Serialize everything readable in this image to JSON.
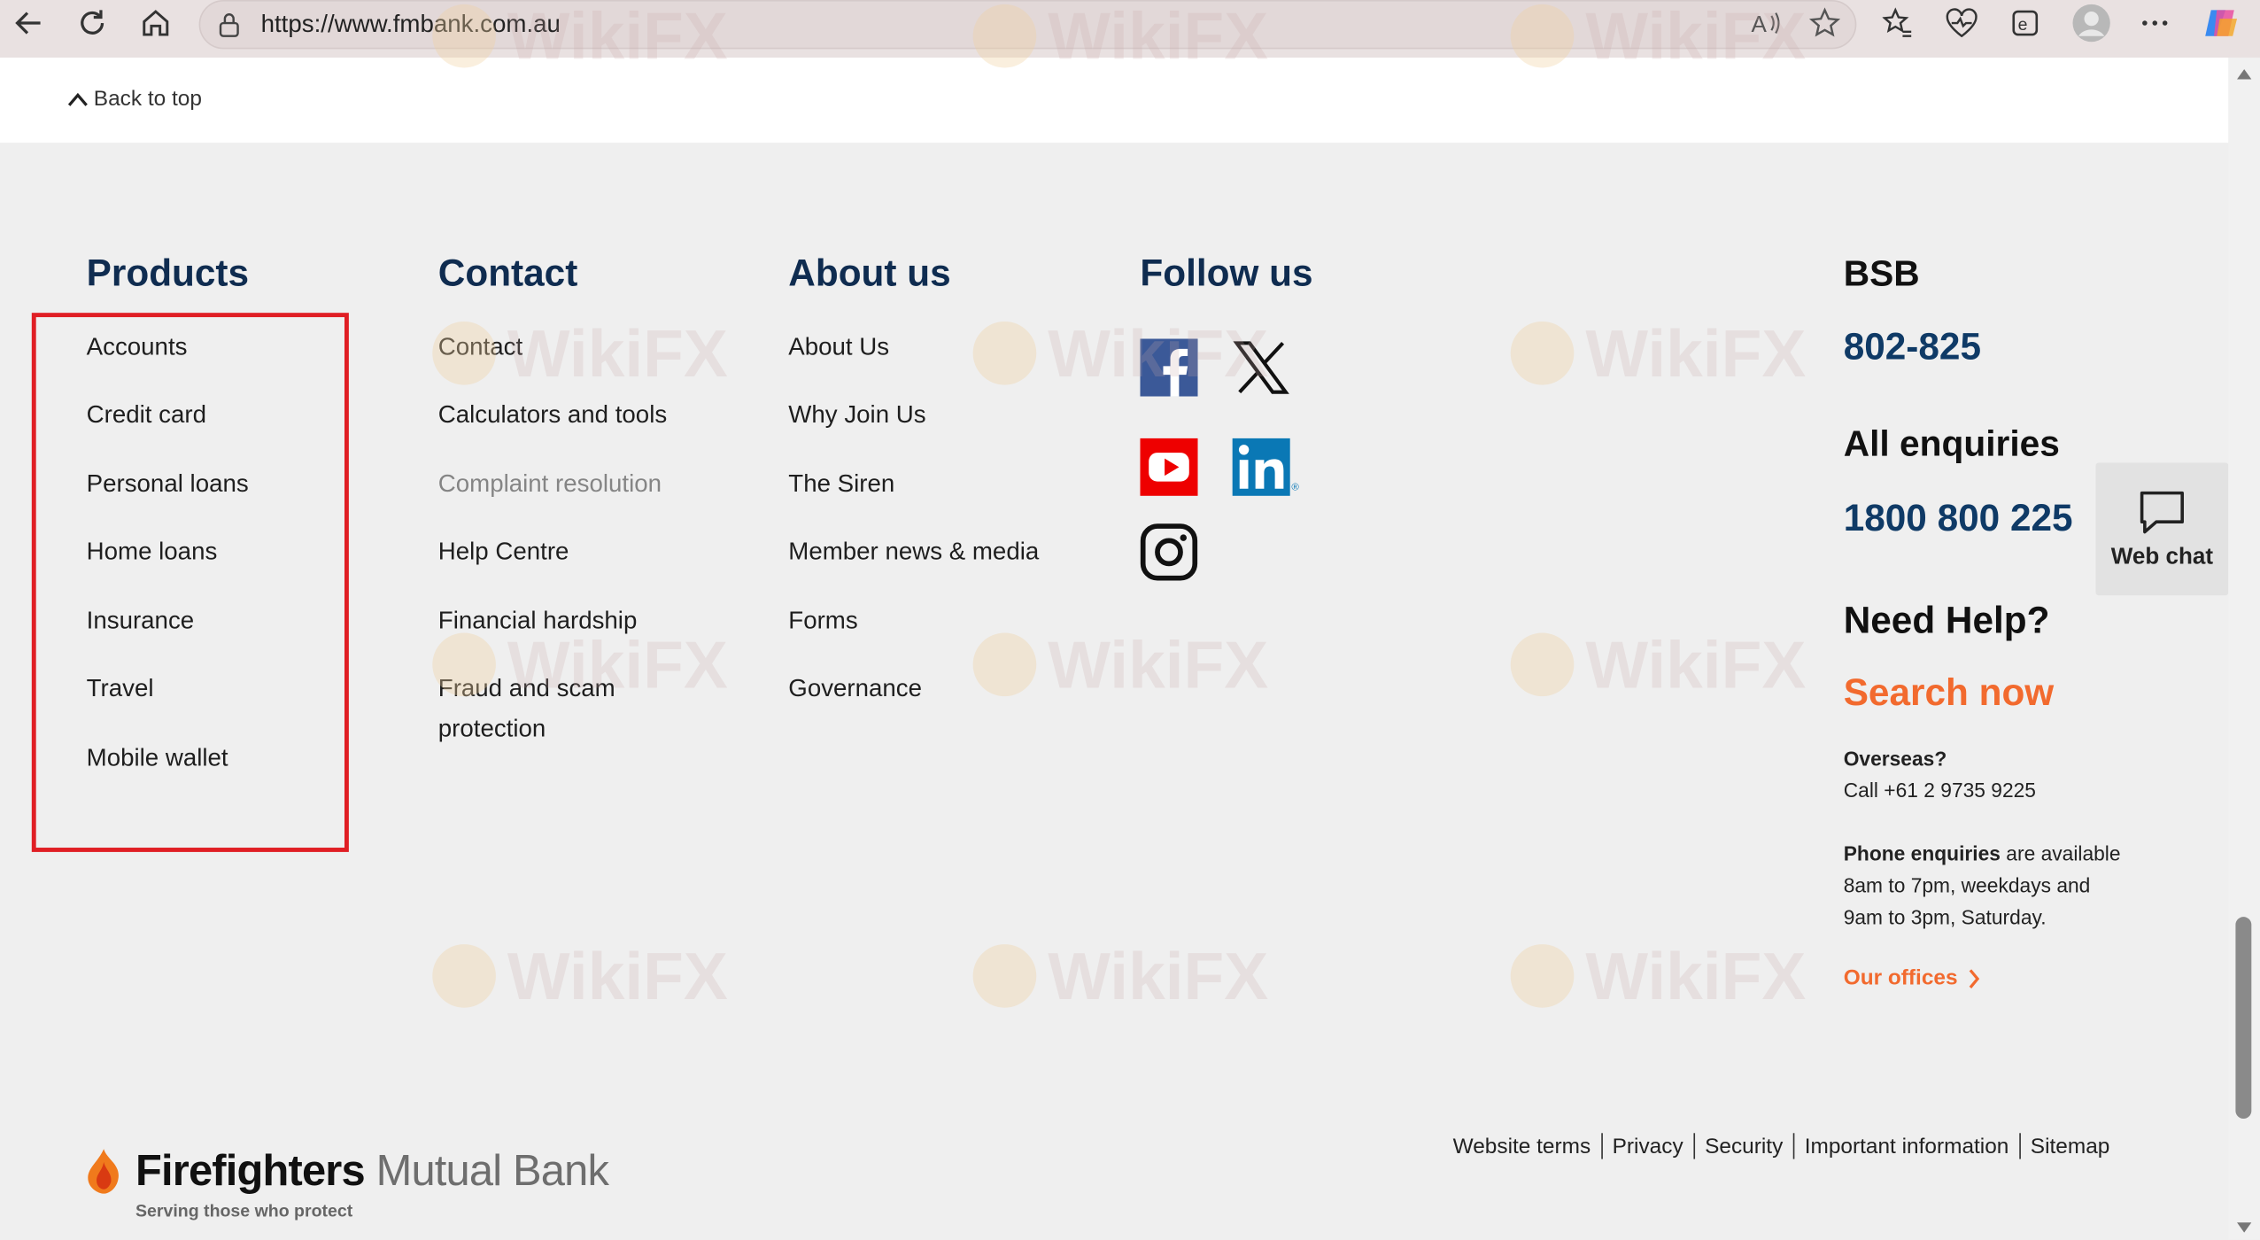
{
  "browser": {
    "url": "https://www.fmbank.com.au"
  },
  "back_to_top": "Back to top",
  "products": {
    "title": "Products",
    "items": [
      "Accounts",
      "Credit card",
      "Personal loans",
      "Home loans",
      "Insurance",
      "Travel",
      "Mobile wallet"
    ]
  },
  "contact": {
    "title": "Contact",
    "items": [
      "Contact",
      "Calculators and tools",
      "Complaint resolution",
      "Help Centre",
      "Financial hardship",
      "Fraud and scam",
      "protection"
    ]
  },
  "about": {
    "title": "About us",
    "items": [
      "About Us",
      "Why Join Us",
      "The Siren",
      "Member news & media",
      "Forms",
      "Governance"
    ]
  },
  "follow": {
    "title": "Follow us",
    "icons": [
      "facebook-icon",
      "x-icon",
      "youtube-icon",
      "linkedin-icon",
      "instagram-icon"
    ]
  },
  "info": {
    "bsb_label": "BSB",
    "bsb_number": "802-825",
    "enquiries_label": "All enquiries",
    "enquiries_number": "1800 800 225",
    "help_label": "Need Help?",
    "search_now": "Search now",
    "overseas_label": "Overseas?",
    "overseas_call": "Call +61 2 9735 9225",
    "phone_bold": "Phone enquiries",
    "phone_rest": " are available",
    "phone_line2": "8am to 7pm, weekdays and",
    "phone_line3": "9am to 3pm, Saturday.",
    "offices": "Our offices"
  },
  "webchat": "Web chat",
  "legal": [
    "Website terms",
    "Privacy",
    "Security",
    "Important information",
    "Sitemap"
  ],
  "logo": {
    "name_bold": "Firefighters",
    "name_light": " Mutual Bank",
    "tagline": "Serving those who protect"
  },
  "watermark": "WikiFX",
  "colors": {
    "navy": "#0f2c50",
    "orange": "#f26a2e",
    "highlight": "#e01e24"
  }
}
